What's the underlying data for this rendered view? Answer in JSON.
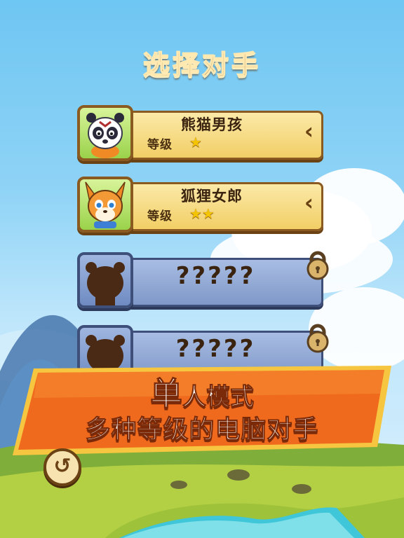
{
  "screen": {
    "title": "选择对手"
  },
  "opponents": [
    {
      "name": "熊猫男孩",
      "level_label": "等级",
      "stars": "★",
      "star_count": 1,
      "locked": false,
      "portrait": "panda-boy-portrait",
      "arrow": "‹"
    },
    {
      "name": "狐狸女郎",
      "level_label": "等级",
      "stars": "★★",
      "star_count": 2,
      "locked": false,
      "portrait": "fox-girl-portrait",
      "arrow": "‹"
    },
    {
      "name": "?????",
      "locked": true,
      "portrait": "silhouette-portrait",
      "lock_icon": "padlock-icon"
    },
    {
      "name": "?????",
      "locked": true,
      "portrait": "silhouette-portrait",
      "lock_icon": "padlock-icon"
    }
  ],
  "banner": {
    "line1_big": "单",
    "line1_rest": "人模式",
    "line2": "多种等级的电脑对手"
  },
  "back_button": {
    "icon": "undo-arrow-icon",
    "glyph": "↺"
  },
  "colors": {
    "sky": "#8fd3f6",
    "unlocked_bar": "#f2cf66",
    "locked_bar": "#7f98c8",
    "banner": "#f06a1e",
    "star": "#f5c400"
  }
}
